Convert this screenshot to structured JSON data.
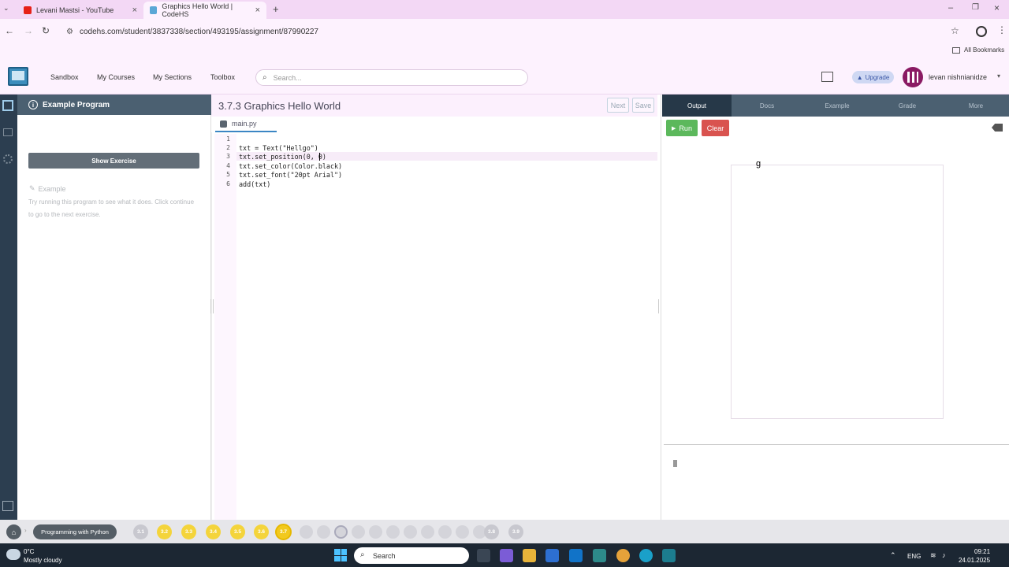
{
  "browser": {
    "tabs": [
      {
        "title": "Levani Mastsi - YouTube",
        "fav_color": "#e62117"
      },
      {
        "title": "Graphics Hello World | CodeHS",
        "fav_color": "#5aa7d6"
      }
    ],
    "url": "codehs.com/student/3837338/section/493195/assignment/87990227",
    "bookmarks_label": "All Bookmarks"
  },
  "nav": {
    "links": [
      "Sandbox",
      "My Courses",
      "My Sections",
      "Toolbox"
    ],
    "search_placeholder": "Search...",
    "upgrade_label": "Upgrade",
    "user_name": "levan nishnianidze"
  },
  "left_panel": {
    "header": "Example Program",
    "show_exercise": "Show Exercise",
    "example_label": "Example",
    "description": "Try running this program to see what it does. Click continue to go to the next exercise."
  },
  "editor": {
    "title": "3.7.3 Graphics Hello World",
    "next_label": "Next",
    "save_label": "Save",
    "file_tab": "main.py",
    "lines": [
      {
        "num": "1",
        "text": ""
      },
      {
        "num": "2",
        "text": "txt = Text(\"Hellgo\")"
      },
      {
        "num": "3",
        "text": "txt.set_position(0, 0)"
      },
      {
        "num": "4",
        "text": "txt.set_color(Color.black)"
      },
      {
        "num": "5",
        "text": "txt.set_font(\"20pt Arial\")"
      },
      {
        "num": "6",
        "text": "add(txt)"
      }
    ]
  },
  "output": {
    "tabs": [
      "Output",
      "Docs",
      "Example",
      "Grade",
      "More"
    ],
    "run_label": "Run",
    "clear_label": "Clear",
    "canvas_glyph": "g"
  },
  "progress": {
    "course_label": "Programming with Python",
    "done_units": [
      "3.1",
      "3.2",
      "3.3",
      "3.4",
      "3.5",
      "3.6",
      "3.7"
    ],
    "after_units": [
      "3.8",
      "3.9"
    ]
  },
  "taskbar": {
    "weather_temp": "0°C",
    "weather_desc": "Mostly cloudy",
    "search_label": "Search",
    "lang": "ENG",
    "time": "09:21",
    "date": "24.01.2025"
  }
}
